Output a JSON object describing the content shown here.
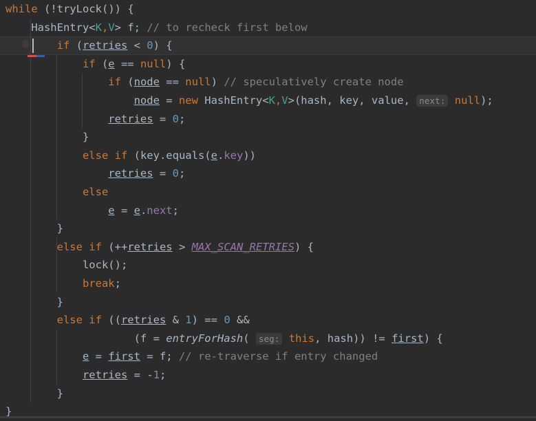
{
  "editor": {
    "name": "code-editor",
    "language": "java",
    "background_color": "#2b2b2b",
    "current_line_color": "#323232",
    "default_text_color": "#a9b7c6",
    "keyword_color": "#cc7832",
    "number_color": "#6897bb",
    "comment_color": "#808080",
    "field_color": "#9876aa",
    "generic_type_color": "#4e9e8e",
    "hint_background_color": "#3b3b3b",
    "caret_color": "#bbbbbb",
    "caret_line_index": 2,
    "font_size_px": 15.5,
    "line_height_px": 26.6
  },
  "code": {
    "lines": [
      {
        "indent": 0,
        "tokens": [
          {
            "t": "while",
            "c": "kw"
          },
          {
            "t": " (!tryLock()) {",
            "c": "plain"
          }
        ]
      },
      {
        "indent": 1,
        "tokens": [
          {
            "t": "HashEntry<",
            "c": "plain"
          },
          {
            "t": "K",
            "c": "gen"
          },
          {
            "t": ",",
            "c": "kw"
          },
          {
            "t": "V",
            "c": "gen"
          },
          {
            "t": "> f; ",
            "c": "plain"
          },
          {
            "t": "// to recheck first below",
            "c": "cmt"
          }
        ]
      },
      {
        "indent": 2,
        "tokens": [
          {
            "t": "if",
            "c": "kw"
          },
          {
            "t": " (",
            "c": "plain"
          },
          {
            "t": "retries",
            "c": "fld"
          },
          {
            "t": " < ",
            "c": "plain"
          },
          {
            "t": "0",
            "c": "num"
          },
          {
            "t": ") {",
            "c": "plain"
          }
        ]
      },
      {
        "indent": 3,
        "tokens": [
          {
            "t": "if",
            "c": "kw"
          },
          {
            "t": " (",
            "c": "plain"
          },
          {
            "t": "e",
            "c": "fld"
          },
          {
            "t": " == ",
            "c": "plain"
          },
          {
            "t": "null",
            "c": "kw"
          },
          {
            "t": ") {",
            "c": "plain"
          }
        ]
      },
      {
        "indent": 4,
        "tokens": [
          {
            "t": "if",
            "c": "kw"
          },
          {
            "t": " (",
            "c": "plain"
          },
          {
            "t": "node",
            "c": "fld"
          },
          {
            "t": " == ",
            "c": "plain"
          },
          {
            "t": "null",
            "c": "kw"
          },
          {
            "t": ") ",
            "c": "plain"
          },
          {
            "t": "// speculatively create node",
            "c": "cmt"
          }
        ]
      },
      {
        "indent": 5,
        "tokens": [
          {
            "t": "node",
            "c": "fld"
          },
          {
            "t": " = ",
            "c": "plain"
          },
          {
            "t": "new",
            "c": "kw"
          },
          {
            "t": " HashEntry<",
            "c": "plain"
          },
          {
            "t": "K",
            "c": "gen"
          },
          {
            "t": ",",
            "c": "kw"
          },
          {
            "t": "V",
            "c": "gen"
          },
          {
            "t": ">(hash, key, value, ",
            "c": "plain"
          },
          {
            "t": "next:",
            "c": "hint"
          },
          {
            "t": " ",
            "c": "plain"
          },
          {
            "t": "null",
            "c": "kw"
          },
          {
            "t": ");",
            "c": "plain"
          }
        ]
      },
      {
        "indent": 4,
        "tokens": [
          {
            "t": "retries",
            "c": "fld"
          },
          {
            "t": " = ",
            "c": "plain"
          },
          {
            "t": "0",
            "c": "num"
          },
          {
            "t": ";",
            "c": "plain"
          }
        ]
      },
      {
        "indent": 3,
        "tokens": [
          {
            "t": "}",
            "c": "plain"
          }
        ]
      },
      {
        "indent": 3,
        "tokens": [
          {
            "t": "else",
            "c": "kw"
          },
          {
            "t": " ",
            "c": "plain"
          },
          {
            "t": "if",
            "c": "kw"
          },
          {
            "t": " (key.equals(",
            "c": "plain"
          },
          {
            "t": "e",
            "c": "fld"
          },
          {
            "t": ".",
            "c": "plain"
          },
          {
            "t": "key",
            "c": "fld2"
          },
          {
            "t": "))",
            "c": "plain"
          }
        ]
      },
      {
        "indent": 4,
        "tokens": [
          {
            "t": "retries",
            "c": "fld"
          },
          {
            "t": " = ",
            "c": "plain"
          },
          {
            "t": "0",
            "c": "num"
          },
          {
            "t": ";",
            "c": "plain"
          }
        ]
      },
      {
        "indent": 3,
        "tokens": [
          {
            "t": "else",
            "c": "kw"
          }
        ]
      },
      {
        "indent": 4,
        "tokens": [
          {
            "t": "e",
            "c": "fld"
          },
          {
            "t": " = ",
            "c": "plain"
          },
          {
            "t": "e",
            "c": "fld"
          },
          {
            "t": ".",
            "c": "plain"
          },
          {
            "t": "next",
            "c": "fld2"
          },
          {
            "t": ";",
            "c": "plain"
          }
        ]
      },
      {
        "indent": 2,
        "tokens": [
          {
            "t": "}",
            "c": "plain"
          }
        ]
      },
      {
        "indent": 2,
        "tokens": [
          {
            "t": "else",
            "c": "kw"
          },
          {
            "t": " ",
            "c": "plain"
          },
          {
            "t": "if",
            "c": "kw"
          },
          {
            "t": " (++",
            "c": "plain"
          },
          {
            "t": "retries",
            "c": "fld"
          },
          {
            "t": " > ",
            "c": "plain"
          },
          {
            "t": "MAX_SCAN_RETRIES",
            "c": "sfld"
          },
          {
            "t": ") {",
            "c": "plain"
          }
        ]
      },
      {
        "indent": 3,
        "tokens": [
          {
            "t": "lock();",
            "c": "plain"
          }
        ]
      },
      {
        "indent": 3,
        "tokens": [
          {
            "t": "break",
            "c": "kw"
          },
          {
            "t": ";",
            "c": "plain"
          }
        ]
      },
      {
        "indent": 2,
        "tokens": [
          {
            "t": "}",
            "c": "plain"
          }
        ]
      },
      {
        "indent": 2,
        "tokens": [
          {
            "t": "else",
            "c": "kw"
          },
          {
            "t": " ",
            "c": "plain"
          },
          {
            "t": "if",
            "c": "kw"
          },
          {
            "t": " ((",
            "c": "plain"
          },
          {
            "t": "retries",
            "c": "fld"
          },
          {
            "t": " & ",
            "c": "plain"
          },
          {
            "t": "1",
            "c": "num"
          },
          {
            "t": ") == ",
            "c": "plain"
          },
          {
            "t": "0",
            "c": "num"
          },
          {
            "t": " &&",
            "c": "plain"
          }
        ]
      },
      {
        "indent": 5,
        "tokens": [
          {
            "t": "(f = ",
            "c": "plain"
          },
          {
            "t": "entryForHash",
            "c": "smeth"
          },
          {
            "t": "( ",
            "c": "plain"
          },
          {
            "t": "seg:",
            "c": "hint"
          },
          {
            "t": " ",
            "c": "plain"
          },
          {
            "t": "this",
            "c": "kw"
          },
          {
            "t": ", hash)) != ",
            "c": "plain"
          },
          {
            "t": "first",
            "c": "fld"
          },
          {
            "t": ") {",
            "c": "plain"
          }
        ]
      },
      {
        "indent": 3,
        "tokens": [
          {
            "t": "e",
            "c": "fld"
          },
          {
            "t": " = ",
            "c": "plain"
          },
          {
            "t": "first",
            "c": "fld"
          },
          {
            "t": " = f; ",
            "c": "plain"
          },
          {
            "t": "// re-traverse if entry changed",
            "c": "cmt"
          }
        ]
      },
      {
        "indent": 3,
        "tokens": [
          {
            "t": "retries",
            "c": "fld"
          },
          {
            "t": " = ",
            "c": "plain"
          },
          {
            "t": "-",
            "c": "plain"
          },
          {
            "t": "1",
            "c": "num"
          },
          {
            "t": ";",
            "c": "plain"
          }
        ]
      },
      {
        "indent": 2,
        "tokens": [
          {
            "t": "}",
            "c": "plain"
          }
        ]
      },
      {
        "indent": 0,
        "tokens": [
          {
            "t": "}",
            "c": "plain"
          }
        ]
      }
    ]
  },
  "indent_guides": [
    {
      "indent": 1,
      "from_line": 1,
      "to_line": 21
    },
    {
      "indent": 2,
      "from_line": 3,
      "to_line": 11
    },
    {
      "indent": 2,
      "from_line": 13,
      "to_line": 15
    },
    {
      "indent": 2,
      "from_line": 18,
      "to_line": 20
    },
    {
      "indent": 3,
      "from_line": 4,
      "to_line": 6
    }
  ]
}
